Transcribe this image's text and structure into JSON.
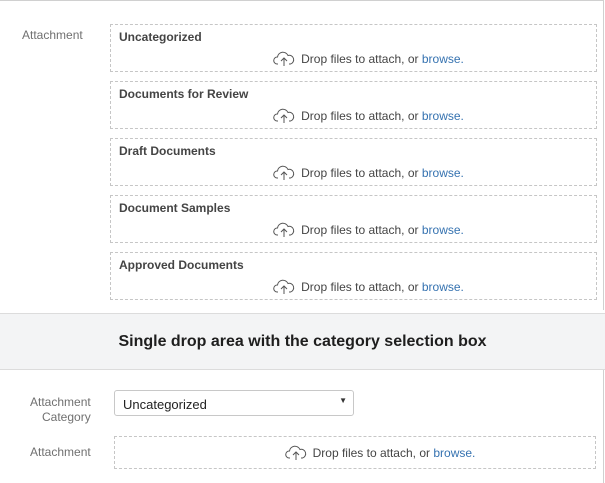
{
  "top": {
    "attachment_label": "Attachment",
    "categories": [
      {
        "title": "Uncategorized"
      },
      {
        "title": "Documents for Review"
      },
      {
        "title": "Draft Documents"
      },
      {
        "title": "Document Samples"
      },
      {
        "title": "Approved Documents"
      }
    ],
    "drop_text": "Drop files to attach, or ",
    "browse_label": "browse."
  },
  "banner": {
    "title": "Single drop area with the category selection box"
  },
  "bottom": {
    "category_label_line1": "Attachment",
    "category_label_line2": "Category",
    "category_select_value": "Uncategorized",
    "select_arrow": "▼",
    "attachment_label": "Attachment",
    "drop_text": "Drop files to attach, or ",
    "browse_label": "browse."
  },
  "icons": {
    "upload": "cloud-upload-icon",
    "dropdown": "chevron-down-icon"
  },
  "colors": {
    "link": "#3572b0",
    "banner_bg": "#f3f4f5",
    "dashed_border": "#c6c6c6"
  }
}
